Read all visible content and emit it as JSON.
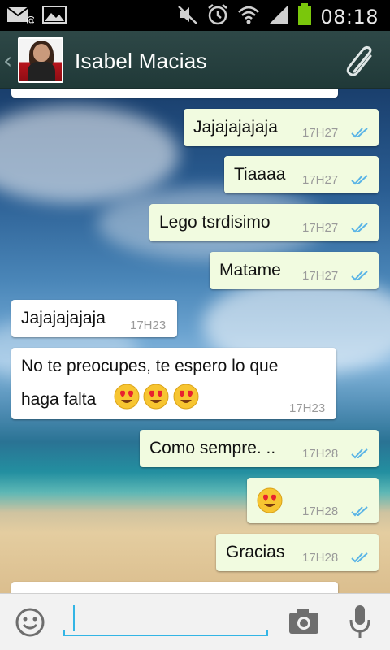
{
  "statusbar": {
    "clock": "08:18",
    "icons": [
      "email-icon",
      "gallery-icon",
      "mute-icon",
      "alarm-icon",
      "wifi-icon",
      "signal-icon",
      "battery-icon"
    ],
    "battery_color": "#7ac70c"
  },
  "header": {
    "contact_name": "Isabel Macias",
    "attach_icon": "paperclip-icon",
    "bg_color": "#2b4544"
  },
  "messages": [
    {
      "dir": "out",
      "text": "Jajajajajaja",
      "time": "17H27",
      "status": "read"
    },
    {
      "dir": "out",
      "text": "Tiaaaa",
      "time": "17H27",
      "status": "read"
    },
    {
      "dir": "out",
      "text": "Lego tsrdisimo",
      "time": "17H27",
      "status": "read"
    },
    {
      "dir": "out",
      "text": "Matame",
      "time": "17H27",
      "status": "read"
    },
    {
      "dir": "in",
      "text": "Jajajajajaja",
      "time": "17H23"
    },
    {
      "dir": "in",
      "text_line1": "No te preocupes, te espero lo que",
      "text_line2": "haga falta",
      "emojis": [
        "heart-eyes-emoji",
        "heart-eyes-emoji",
        "heart-eyes-emoji"
      ],
      "time": "17H23"
    },
    {
      "dir": "out",
      "text": "Como sempre. ..",
      "time": "17H28",
      "status": "read"
    },
    {
      "dir": "out",
      "emojis": [
        "heart-eyes-emoji"
      ],
      "time": "17H28",
      "status": "read"
    },
    {
      "dir": "out",
      "text": "Gracias",
      "time": "17H28",
      "status": "read"
    }
  ],
  "composer": {
    "placeholder": "",
    "value": "",
    "emoji_icon": "smiley-icon",
    "camera_icon": "camera-icon",
    "mic_icon": "microphone-icon",
    "accent_color": "#33b5e5"
  },
  "colors": {
    "outgoing_bubble": "#f1fbe0",
    "incoming_bubble": "#ffffff",
    "read_ticks": "#5ab4e6"
  }
}
